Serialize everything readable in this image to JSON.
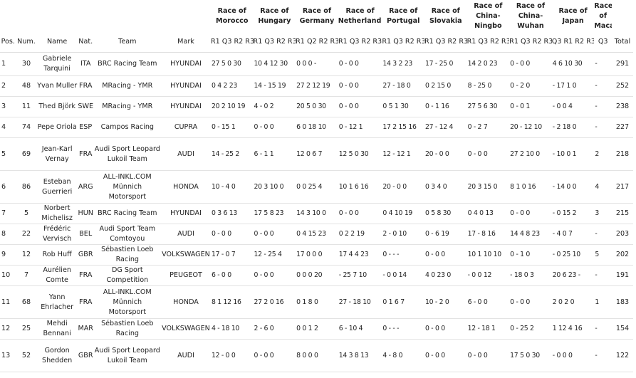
{
  "table": {
    "races": [
      "Race of Morocco",
      "Race of Hungary",
      "Race of Germany",
      "Race of Netherlands",
      "Race of Portugal",
      "Race of Slovakia",
      "Race of China-Ningbo",
      "Race of China-Wuhan",
      "Race of Japan",
      "Race of Macau"
    ],
    "columns": {
      "pos": "Pos.",
      "num": "Num.",
      "name": "Name",
      "nat": "Nat.",
      "team": "Team",
      "mark": "Mark",
      "total": "Total"
    },
    "subheaders": [
      "R1 Q3 R2 R3",
      "R1 Q3 R2 R3",
      "R1 Q2 R2 R3",
      "R1 Q3 R2 R3",
      "R1 Q3 R2 R3",
      "R1 Q3 R2 R3",
      "R1 Q3 R2 R3",
      "R1 Q3 R2 R3",
      "Q3 R1 R2 R3",
      "Q3"
    ],
    "rows": [
      {
        "pos": "1",
        "num": "30",
        "name": "Gabriele Tarquini",
        "nat": "ITA",
        "team": "BRC Racing Team",
        "mark": "HYUNDAI",
        "results": [
          "27 5 0 30",
          "10 4 12 30",
          "0 0 0 -",
          "0 - 0 0",
          "14 3 2 23",
          "17 - 25 0",
          "14 2 0 23",
          "0 - 0 0",
          "4 6 10 30",
          "-"
        ],
        "total": "291"
      },
      {
        "pos": "2",
        "num": "48",
        "name": "Yvan Muller",
        "nat": "FRA",
        "team": "MRacing - YMR",
        "mark": "HYUNDAI",
        "results": [
          "0 4 2 23",
          "14 - 15 19",
          "27 2 12 19",
          "0 - 0 0",
          "27 - 18 0",
          "0 2 15 0",
          "8 - 25 0",
          "0 - 2 0",
          "- 17 1 0",
          "-"
        ],
        "total": "252"
      },
      {
        "pos": "3",
        "num": "11",
        "name": "Thed Björk",
        "nat": "SWE",
        "team": "MRacing - YMR",
        "mark": "HYUNDAI",
        "results": [
          "20 2 10 19",
          "4 - 0 2",
          "20 5 0 30",
          "0 - 0 0",
          "0 5 1 30",
          "0 - 1 16",
          "27 5 6 30",
          "0 - 0 1",
          "- 0 0 4",
          "-"
        ],
        "total": "238"
      },
      {
        "pos": "4",
        "num": "74",
        "name": "Pepe Oriola",
        "nat": "ESP",
        "team": "Campos Racing",
        "mark": "CUPRA",
        "results": [
          "0 - 15 1",
          "0 - 0 0",
          "6 0 18 10",
          "0 - 12 1",
          "17 2 15 16",
          "27 - 12 4",
          "0 - 2 7",
          "20 - 12 10",
          "- 2 18 0",
          "-"
        ],
        "total": "227"
      },
      {
        "pos": "5",
        "num": "69",
        "name": "Jean-Karl Vernay",
        "nat": "FRA",
        "team": "Audi Sport Leopard Lukoil Team",
        "mark": "AUDI",
        "results": [
          "14 - 25 2",
          "6 - 1 1",
          "12 0 6 7",
          "12 5 0 30",
          "12 - 12 1",
          "20 - 0 0",
          "0 - 0 0",
          "27 2 10 0",
          "- 10 0 1",
          "2"
        ],
        "total": "218"
      },
      {
        "pos": "6",
        "num": "86",
        "name": "Esteban Guerrieri",
        "nat": "ARG",
        "team": "ALL-INKL.COM Münnich Motorsport",
        "mark": "HONDA",
        "results": [
          "10 - 4 0",
          "20 3 10 0",
          "0 0 25 4",
          "10 1 6 16",
          "20 - 0 0",
          "0 3 4 0",
          "20 3 15 0",
          "8 1 0 16",
          "- 14 0 0",
          "4"
        ],
        "total": "217"
      },
      {
        "pos": "7",
        "num": "5",
        "name": "Norbert Michelisz",
        "nat": "HUN",
        "team": "BRC Racing Team",
        "mark": "HYUNDAI",
        "results": [
          "0 3 6 13",
          "17 5 8 23",
          "14 3 10 0",
          "0 - 0 0",
          "0 4 10 19",
          "0 5 8 30",
          "0 4 0 13",
          "0 - 0 0",
          "- 0 15 2",
          "3"
        ],
        "total": "215"
      },
      {
        "pos": "8",
        "num": "22",
        "name": "Frédéric Vervisch",
        "nat": "BEL",
        "team": "Audi Sport Team Comtoyou",
        "mark": "AUDI",
        "results": [
          "0 - 0 0",
          "0 - 0 0",
          "0 4 15 23",
          "0 2 2 19",
          "2 - 0 10",
          "0 - 6 19",
          "17 - 8 16",
          "14 4 8 23",
          "- 4 0 7",
          "-"
        ],
        "total": "203"
      },
      {
        "pos": "9",
        "num": "12",
        "name": "Rob Huff",
        "nat": "GBR",
        "team": "Sébastien Loeb Racing",
        "mark": "VOLKSWAGEN",
        "results": [
          "17 - 0 7",
          "12 - 25 4",
          "17 0 0 0",
          "17 4 4 23",
          "0 - - -",
          "0 - 0 0",
          "10 1 10 10",
          "0 - 1 0",
          "- 0 25 10",
          "5"
        ],
        "total": "202"
      },
      {
        "pos": "10",
        "num": "7",
        "name": "Aurélien Comte",
        "nat": "FRA",
        "team": "DG Sport Competition",
        "mark": "PEUGEOT",
        "results": [
          "6 - 0 0",
          "0 - 0 0",
          "0 0 0 20",
          "- 25 7 10",
          "- 0 0 14",
          "4 0 23 0",
          "- 0 0 12",
          "- 18 0 3",
          "20 6 23 -",
          "-"
        ],
        "total": "191"
      },
      {
        "pos": "11",
        "num": "68",
        "name": "Yann Ehrlacher",
        "nat": "FRA",
        "team": "ALL-INKL.COM Münnich Motorsport",
        "mark": "HONDA",
        "results": [
          "8 1 12 16",
          "27 2 0 16",
          "0 1 8 0",
          "27 - 18 10",
          "0 1 6 7",
          "10 - 2 0",
          "6 - 0 0",
          "0 - 0 0",
          "2 0 2 0",
          "1"
        ],
        "total": "183"
      },
      {
        "pos": "12",
        "num": "25",
        "name": "Mehdi Bennani",
        "nat": "MAR",
        "team": "Sébastien Loeb Racing",
        "mark": "VOLKSWAGEN",
        "results": [
          "4 - 18 10",
          "2 - 6 0",
          "0 0 1 2",
          "6 - 10 4",
          "0 - - -",
          "0 - 0 0",
          "12 - 18 1",
          "0 - 25 2",
          "1 12 4 16",
          "-"
        ],
        "total": "154"
      },
      {
        "pos": "13",
        "num": "52",
        "name": "Gordon Shedden",
        "nat": "GBR",
        "team": "Audi Sport Leopard Lukoil Team",
        "mark": "AUDI",
        "results": [
          "12 - 0 0",
          "0 - 0 0",
          "8 0 0 0",
          "14 3 8 13",
          "4 - 8 0",
          "0 - 0 0",
          "0 - 0 0",
          "17 5 0 30",
          "- 0 0 0",
          "-"
        ],
        "total": "122"
      }
    ]
  }
}
